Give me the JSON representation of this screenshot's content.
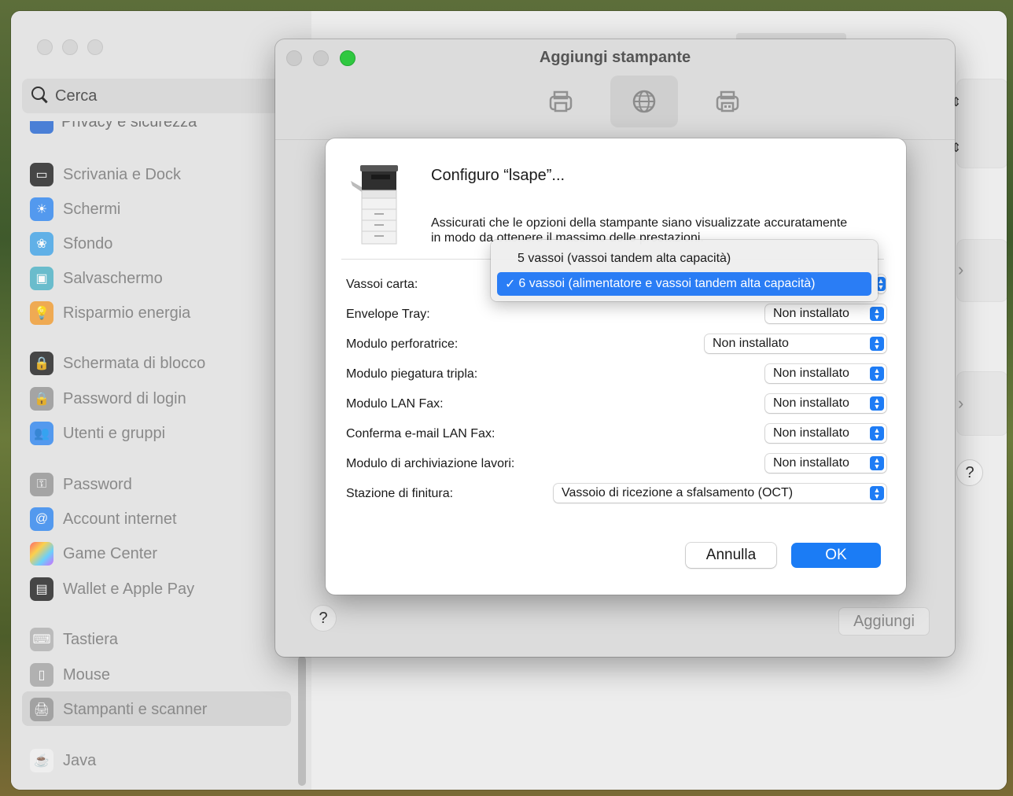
{
  "sidebar": {
    "search_placeholder": "Cerca",
    "cut_item": "Privacy e sicurezza",
    "items": [
      {
        "label": "Scrivania e Dock"
      },
      {
        "label": "Schermi"
      },
      {
        "label": "Sfondo"
      },
      {
        "label": "Salvaschermo"
      },
      {
        "label": "Risparmio energia"
      },
      {
        "label": "Schermata di blocco"
      },
      {
        "label": "Password di login"
      },
      {
        "label": "Utenti e gruppi"
      },
      {
        "label": "Password"
      },
      {
        "label": "Account internet"
      },
      {
        "label": "Game Center"
      },
      {
        "label": "Wallet e Apple Pay"
      },
      {
        "label": "Tastiera"
      },
      {
        "label": "Mouse"
      },
      {
        "label": "Stampanti e scanner"
      },
      {
        "label": "Java"
      }
    ]
  },
  "add_printer": {
    "title": "Aggiungi stampante",
    "help": "?",
    "add_button": "Aggiungi"
  },
  "pane": {
    "help": "?"
  },
  "dialog": {
    "title": "Configuro “lsape”...",
    "description": "Assicurati che le opzioni della stampante siano visualizzate accuratamente in modo da ottenere il massimo delle prestazioni.",
    "options": [
      {
        "label": "Vassoi carta:",
        "value": ""
      },
      {
        "label": "Envelope Tray:",
        "value": "Non installato"
      },
      {
        "label": "Modulo perforatrice:",
        "value": "Non installato"
      },
      {
        "label": "Modulo piegatura tripla:",
        "value": "Non installato"
      },
      {
        "label": "Modulo LAN Fax:",
        "value": "Non installato"
      },
      {
        "label": "Conferma e-mail LAN Fax:",
        "value": "Non installato"
      },
      {
        "label": "Modulo di archiviazione lavori:",
        "value": "Non installato"
      },
      {
        "label": "Stazione di finitura:",
        "value": "Vassoio di ricezione a sfalsamento (OCT)"
      }
    ],
    "cancel_button": "Annulla",
    "ok_button": "OK"
  },
  "menu": {
    "items": [
      {
        "label": "5 vassoi (vassoi tandem alta capacità)",
        "selected": false
      },
      {
        "label": "6 vassoi (alimentatore e vassoi tandem alta capacità)",
        "selected": true
      }
    ],
    "check": "✓"
  },
  "colors": {
    "accent": "#1b7cf5",
    "traffic_green": "#2fc840"
  }
}
